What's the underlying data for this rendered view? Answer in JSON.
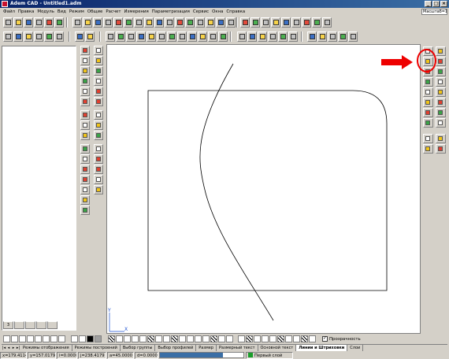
{
  "window": {
    "title": "Adem CAD - Untitled1.adm"
  },
  "menu": [
    "Файл",
    "Правка",
    "Модуль",
    "Вид",
    "Режим",
    "Общие",
    "Расчет",
    "Измерения",
    "Параметризация",
    "Сервис",
    "Окна",
    "Справка"
  ],
  "scale": {
    "value": "Масштаб=1:1"
  },
  "left_tabs": [
    "3",
    "",
    "",
    "",
    ""
  ],
  "layer_toolbar": {
    "transparency_label": "Прозрачность",
    "transparency_checked": true
  },
  "tabs": {
    "items": [
      "Режимы отображения",
      "Режимы построений",
      "Выбор группы",
      "Выбор профилей",
      "Размер",
      "Размерный текст",
      "Основной текст",
      "Линии и Штриховки",
      "Слои"
    ],
    "active_index": 7
  },
  "status": {
    "x": "x=179.4114",
    "y": "y=157.0179",
    "i": "i=0.0000",
    "j": "j=238.4179",
    "a": "a=45.0000",
    "d": "d=0.0000",
    "layer": "Первый слой",
    "progress": 0.75
  },
  "icons": {
    "highlighted_tool": "rounded-rectangle-icon",
    "annotation": "red-arrow-icon"
  },
  "colors": {
    "titlebar": "#0a246a",
    "highlight": "#ee0000",
    "layer": "#1a9e2a",
    "progress": "#3a6ea5"
  }
}
